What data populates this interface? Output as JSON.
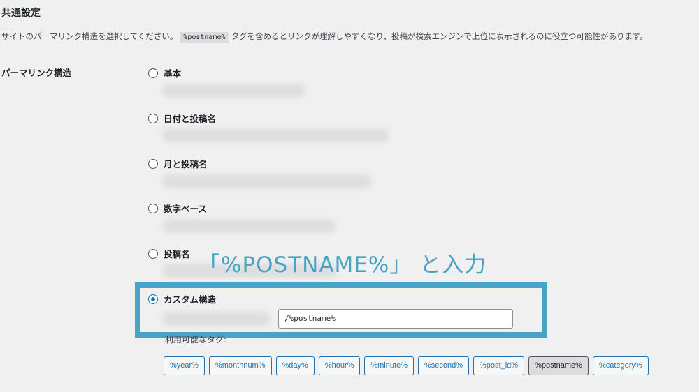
{
  "section_title": "共通設定",
  "description": {
    "before": "サイトのパーマリンク構造を選択してください。",
    "code": "%postname%",
    "after": "タグを含めるとリンクが理解しやすくなり、投稿が検索エンジンで上位に表示されるのに役立つ可能性があります。"
  },
  "permalink_label": "パーマリンク構造",
  "options": [
    {
      "label": "基本",
      "checked": false
    },
    {
      "label": "日付と投稿名",
      "checked": false
    },
    {
      "label": "月と投稿名",
      "checked": false
    },
    {
      "label": "数字ベース",
      "checked": false
    },
    {
      "label": "投稿名",
      "checked": false
    },
    {
      "label": "カスタム構造",
      "checked": true
    }
  ],
  "annotation": "「%POSTNAME%」 と入力",
  "custom_structure_value": "/%postname%",
  "available_tags_label": "利用可能なタグ:",
  "tags": [
    {
      "label": "%year%",
      "active": false
    },
    {
      "label": "%monthnum%",
      "active": false
    },
    {
      "label": "%day%",
      "active": false
    },
    {
      "label": "%hour%",
      "active": false
    },
    {
      "label": "%minute%",
      "active": false
    },
    {
      "label": "%second%",
      "active": false
    },
    {
      "label": "%post_id%",
      "active": false
    },
    {
      "label": "%postname%",
      "active": true
    },
    {
      "label": "%category%",
      "active": false
    }
  ],
  "colors": {
    "accent": "#2271b1",
    "annotation": "#4aa3c4",
    "background": "#f0f0f1"
  }
}
